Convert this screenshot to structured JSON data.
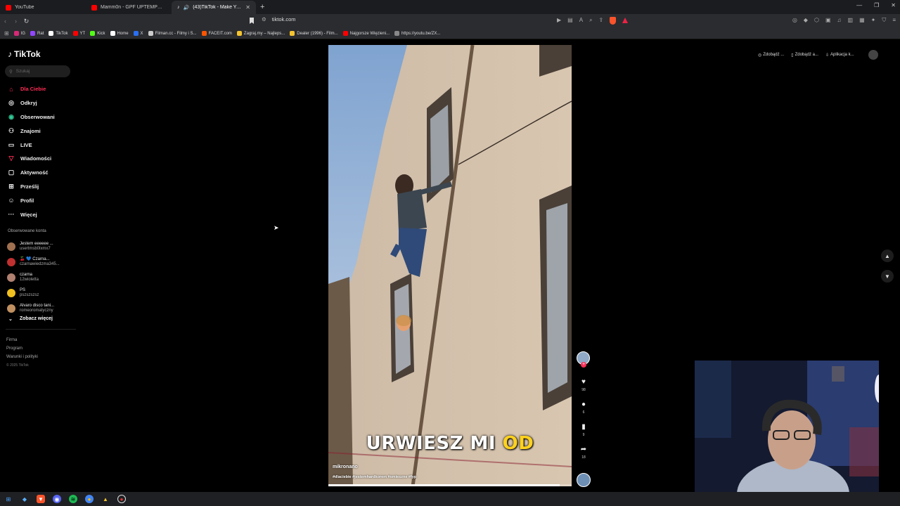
{
  "browser": {
    "tabs": [
      {
        "title": "YouTube",
        "color": "#ff0000",
        "active": false
      },
      {
        "title": "Mamm0n - GPF UPTEMPO MIX",
        "color": "#ff0000",
        "active": false
      },
      {
        "title": "(43)TikTok - Make Your Day",
        "color": "#ffffff",
        "active": true
      }
    ],
    "url": "tiktok.com",
    "bookmarks": [
      {
        "label": "IG",
        "color": "#d62976"
      },
      {
        "label": "Rat",
        "color": "#9146ff"
      },
      {
        "label": "TikTok",
        "color": "#ffffff"
      },
      {
        "label": "YT",
        "color": "#ff0000"
      },
      {
        "label": "Kick",
        "color": "#53fc18"
      },
      {
        "label": "Home",
        "color": "#ffffff"
      },
      {
        "label": "X",
        "color": "#2a6ff0"
      },
      {
        "label": "Filman.cc - Filmy i S...",
        "color": "#cccccc"
      },
      {
        "label": "FACEIT.com",
        "color": "#ff5500"
      },
      {
        "label": "Zagraj.my – Najleps...",
        "color": "#f4c430"
      },
      {
        "label": "Dealer (1996) - Film...",
        "color": "#f4c430"
      },
      {
        "label": "Najgorsze Więzieni...",
        "color": "#ff0000"
      },
      {
        "label": "https://youtu.be/ZX...",
        "color": "#888888"
      }
    ]
  },
  "sidebar": {
    "logo": "TikTok",
    "search_placeholder": "Szukaj",
    "nav": [
      {
        "label": "Dla Ciebie",
        "icon": "home-icon",
        "active": true
      },
      {
        "label": "Odkryj",
        "icon": "compass-icon"
      },
      {
        "label": "Obserwowani",
        "icon": "following-icon"
      },
      {
        "label": "Znajomi",
        "icon": "friends-icon"
      },
      {
        "label": "LIVE",
        "icon": "live-icon"
      },
      {
        "label": "Wiadomości",
        "icon": "messages-icon"
      },
      {
        "label": "Aktywność",
        "icon": "activity-icon"
      },
      {
        "label": "Prześlij",
        "icon": "upload-icon"
      },
      {
        "label": "Profil",
        "icon": "profile-icon"
      },
      {
        "label": "Więcej",
        "icon": "more-icon"
      }
    ],
    "following_title": "Obserwowane konta",
    "following": [
      {
        "name": "Jestem eeeeee ...",
        "user": "usertmsb0lxmx7",
        "color": "#a07050"
      },
      {
        "name": "🍒 💙 Czarna...",
        "user": "czarnawiedzma345...",
        "color": "#c03030"
      },
      {
        "name": "czarna",
        "user": "12wioletta",
        "color": "#b08070"
      },
      {
        "name": "PS",
        "user": "pszszszsz",
        "color": "#f0c020"
      },
      {
        "name": "Alvaro disco tani...",
        "user": "romeoromatyczny",
        "color": "#c09060"
      }
    ],
    "see_more": "Zobacz więcej",
    "footer": [
      "Firma",
      "Program",
      "Warunki i polityki"
    ],
    "copyright": "© 2025 TikTok"
  },
  "top_actions": [
    "Zdobądź ...",
    "Zdobądź a...",
    "Aplikacja k..."
  ],
  "video": {
    "caption_white": "URWIESZ MI",
    "caption_yellow": "OD",
    "author": "mikronano",
    "tags": "#dlaciebie #jestemhardkorem #smieszne #fyp",
    "progress": 0.95
  },
  "actions": {
    "likes": "98",
    "comments": "6",
    "saves": "9",
    "shares": "18"
  }
}
